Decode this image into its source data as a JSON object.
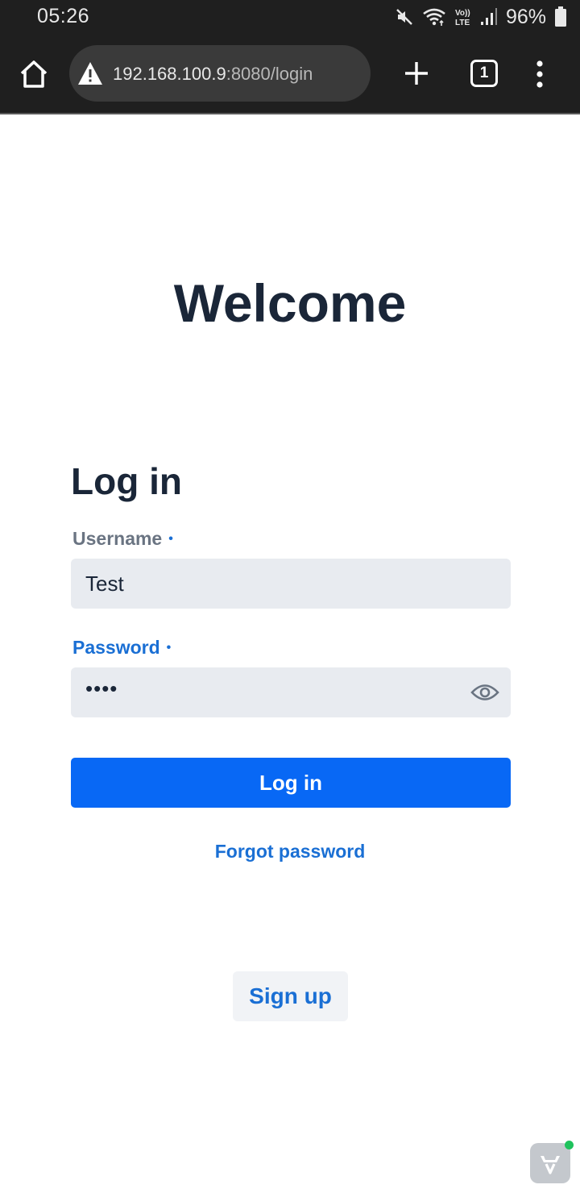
{
  "status_bar": {
    "time": "05:26",
    "battery_text": "96%",
    "icons": [
      "mute-icon",
      "wifi-icon",
      "volte-icon",
      "signal-icon",
      "battery-icon"
    ]
  },
  "browser": {
    "url_host": "192.168.100.9",
    "url_path": ":8080/login",
    "tab_count": "1",
    "icons": [
      "home-icon",
      "warning-icon",
      "plus-icon",
      "tabs-icon",
      "more-vert-icon"
    ]
  },
  "page": {
    "welcome_title": "Welcome",
    "login_heading": "Log in",
    "username_label": "Username",
    "username_value": "Test",
    "password_label": "Password",
    "password_mask": "••••",
    "required_marker": "•",
    "login_button": "Log in",
    "forgot_link": "Forgot password",
    "signup_button": "Sign up"
  },
  "colors": {
    "primary": "#0868f5",
    "link": "#1a6fd4",
    "heading": "#1a2638",
    "field_bg": "#e8ebf0",
    "statusbar_bg": "#1f1f1f",
    "badge_dot": "#1fc25c"
  }
}
